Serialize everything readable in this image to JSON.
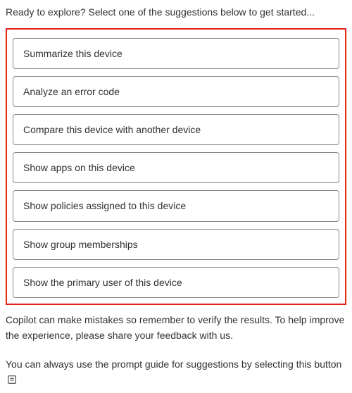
{
  "intro": "Ready to explore? Select one of the suggestions below to get started...",
  "suggestions": [
    {
      "label": "Summarize this device"
    },
    {
      "label": "Analyze an error code"
    },
    {
      "label": "Compare this device with another device"
    },
    {
      "label": "Show apps on this device"
    },
    {
      "label": "Show policies assigned to this device"
    },
    {
      "label": "Show group memberships"
    },
    {
      "label": "Show the primary user of this device"
    }
  ],
  "disclaimer": "Copilot can make mistakes so remember to verify the results. To help improve the experience, please share your feedback with us.",
  "guide_prefix": "You can always use the prompt guide for suggestions by selecting this button",
  "icons": {
    "prompt_guide": "prompt-guide-icon"
  }
}
